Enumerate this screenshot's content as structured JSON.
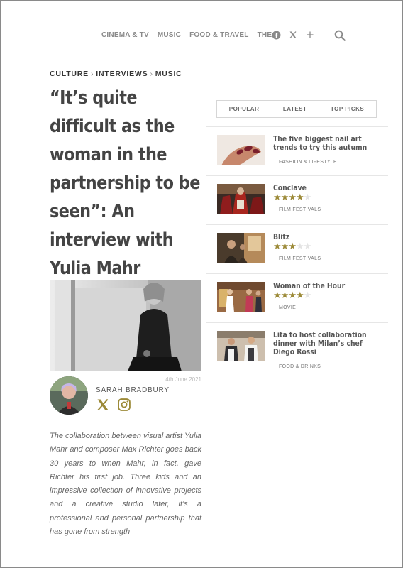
{
  "nav": {
    "items": [
      "CINEMA & TV",
      "MUSIC",
      "FOOD & TRAVEL",
      "THE"
    ],
    "icons": [
      "facebook-icon",
      "x-icon",
      "plus-icon",
      "search-icon"
    ]
  },
  "article": {
    "breadcrumb": [
      "CULTURE",
      "INTERVIEWS",
      "MUSIC"
    ],
    "title": "“It’s quite difficult as the woman in the partnership to be seen”: An interview with Yulia Mahr",
    "date": "4th June 2021",
    "author": "SARAH BRADBURY",
    "lede": "The collaboration between visual artist Yulia Mahr and composer Max Richter goes back 30 years to when Mahr, in fact, gave Richter his first job. Three kids and an impressive collection of innovative projects and a creative studio later, it’s a professional and personal partnership that has gone from strength"
  },
  "sidebar": {
    "tabs": [
      "POPULAR",
      "LATEST",
      "TOP PICKS"
    ],
    "items": [
      {
        "title": "The five biggest nail art trends to try this autumn",
        "rating": null,
        "category": "FASHION & LIFESTYLE"
      },
      {
        "title": "Conclave",
        "rating": 4,
        "category": "FILM FESTIVALS"
      },
      {
        "title": "Blitz",
        "rating": 3,
        "category": "FILM FESTIVALS"
      },
      {
        "title": "Woman of the Hour",
        "rating": 4,
        "category": "MOVIE"
      },
      {
        "title": "Lita to host collaboration dinner with Milan’s chef Diego Rossi",
        "rating": null,
        "category": "FOOD & DRINKS"
      }
    ]
  },
  "colors": {
    "accent": "#9c8a38",
    "nav_grey": "#8a8a8a",
    "text": "#444444"
  }
}
